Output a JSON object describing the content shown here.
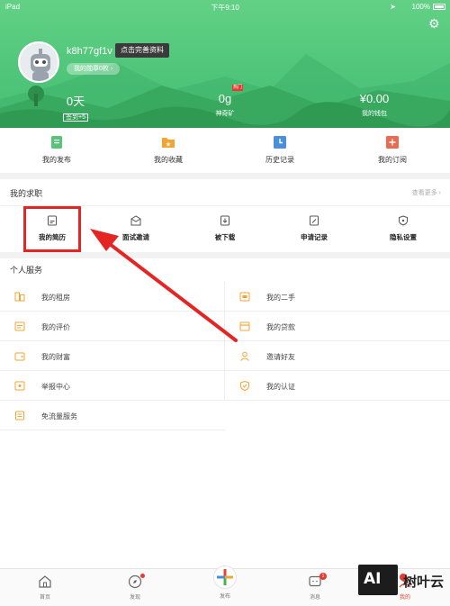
{
  "status_bar": {
    "carrier": "iPad",
    "time": "下午9:10",
    "battery": "100%"
  },
  "profile": {
    "username": "k8h77gf1v",
    "edit_tip": "点击完善资料",
    "badges": "我的勋章0枚 ›"
  },
  "stats": {
    "days_value": "0天",
    "days_label": "签到+5",
    "ore_value": "0g",
    "ore_tag": "热门",
    "ore_label": "神奇矿",
    "wallet_value": "¥0.00",
    "wallet_label": "我的钱包"
  },
  "quick_nav": [
    {
      "label": "我的发布",
      "icon": "document-icon",
      "color": "#5bc27a"
    },
    {
      "label": "我的收藏",
      "icon": "folder-star-icon",
      "color": "#f3a534"
    },
    {
      "label": "历史记录",
      "icon": "clock-icon",
      "color": "#4a90d9"
    },
    {
      "label": "我的订阅",
      "icon": "plus-box-icon",
      "color": "#ea6a52"
    }
  ],
  "job": {
    "title": "我的求职",
    "more": "查看更多 ›",
    "items": [
      {
        "label": "我的简历",
        "icon": "resume-icon"
      },
      {
        "label": "面试邀请",
        "icon": "envelope-icon"
      },
      {
        "label": "被下载",
        "icon": "download-icon"
      },
      {
        "label": "申请记录",
        "icon": "edit-doc-icon"
      },
      {
        "label": "隐私设置",
        "icon": "shield-icon"
      }
    ]
  },
  "services": {
    "title": "个人服务",
    "items": [
      {
        "label": "我的租房",
        "icon": "house-icon"
      },
      {
        "label": "我的二手",
        "icon": "secondhand-icon"
      },
      {
        "label": "我的评价",
        "icon": "comment-icon"
      },
      {
        "label": "我的贷款",
        "icon": "loan-icon"
      },
      {
        "label": "我的财富",
        "icon": "wallet-icon"
      },
      {
        "label": "邀请好友",
        "icon": "person-icon"
      },
      {
        "label": "举报中心",
        "icon": "eye-icon"
      },
      {
        "label": "我的认证",
        "icon": "shield-check-icon"
      },
      {
        "label": "免流量服务",
        "icon": "traffic-icon"
      }
    ]
  },
  "tabbar": [
    {
      "label": "首页",
      "icon": "home-icon"
    },
    {
      "label": "发现",
      "icon": "compass-icon"
    },
    {
      "label": "发布",
      "icon": "publish-plus-icon"
    },
    {
      "label": "消息",
      "icon": "message-icon",
      "count": "1"
    },
    {
      "label": "我的",
      "icon": "me-icon"
    }
  ],
  "watermark": {
    "logo": "AI",
    "text": "树叶云"
  },
  "colors": {
    "brand_green": "#4fc57a",
    "highlight_red": "#e52424",
    "accent_orange": "#f3a534"
  }
}
